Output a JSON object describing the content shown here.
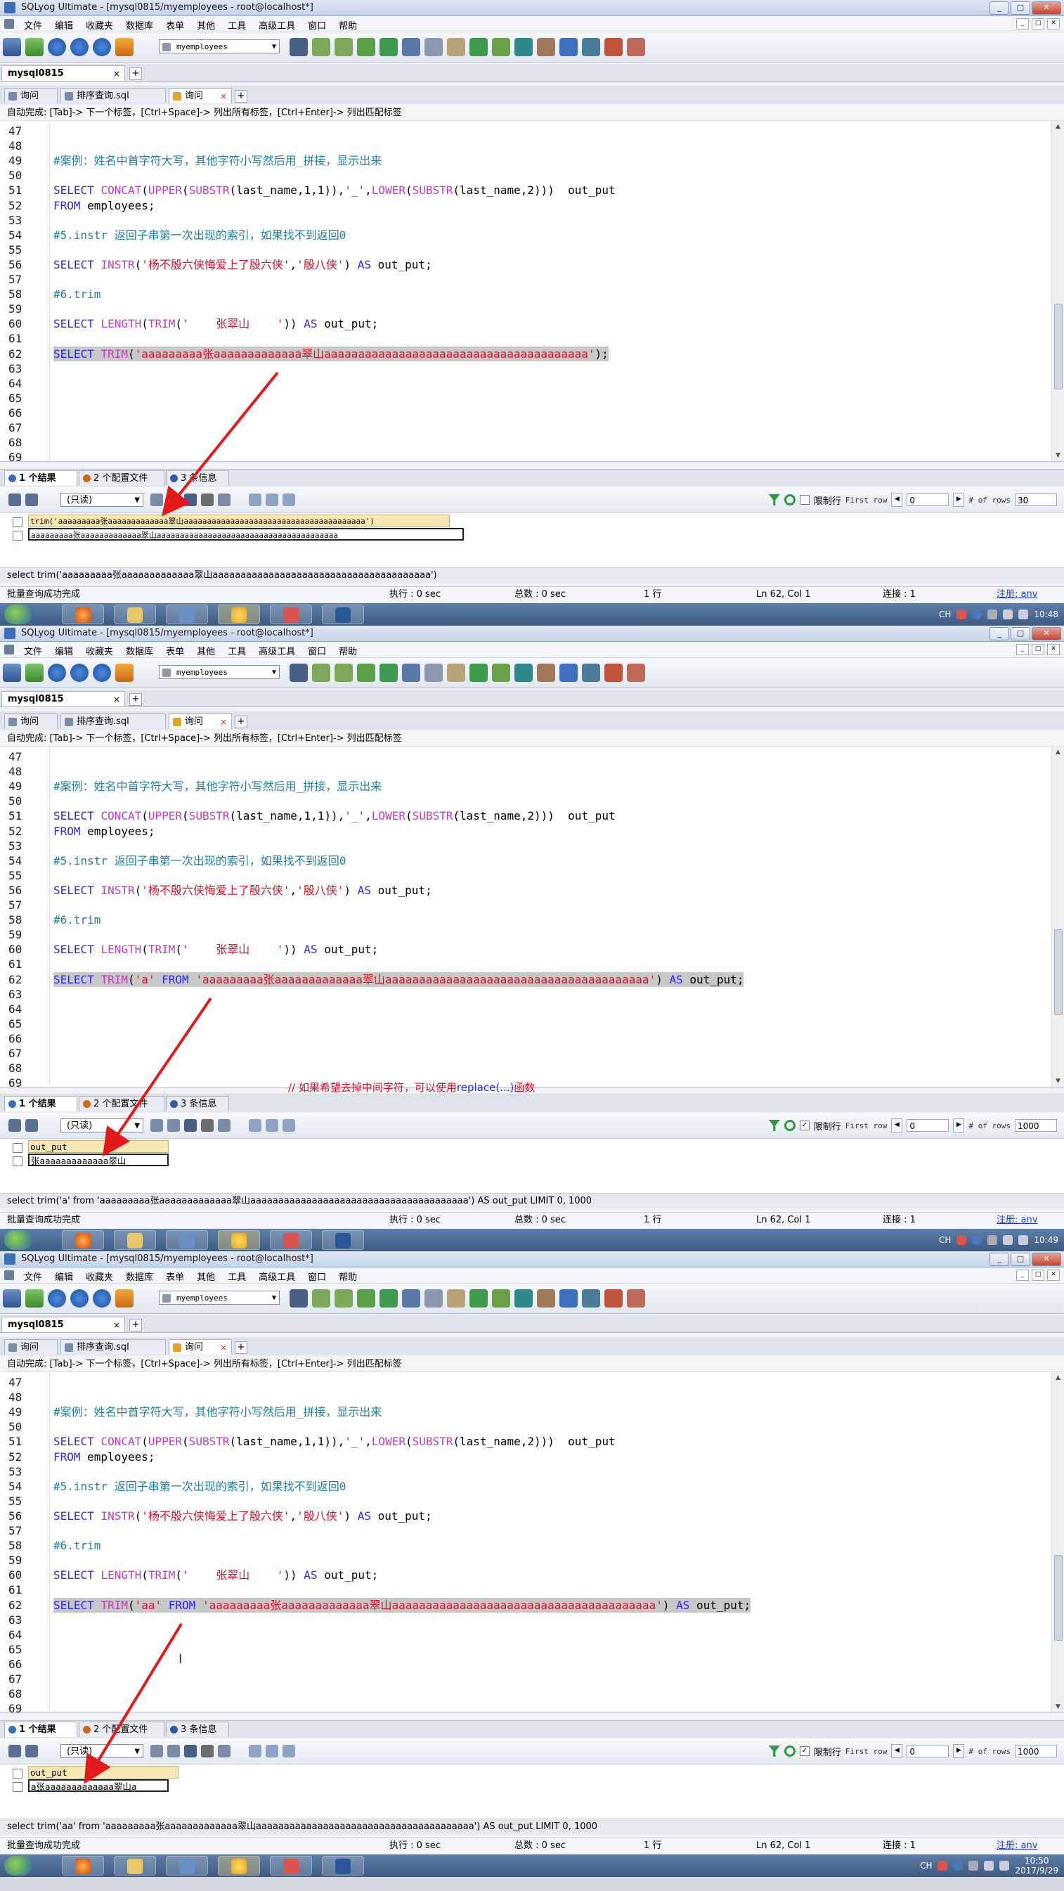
{
  "app": {
    "window_title": "SQLyog Ultimate - [mysql0815/myemployees - root@localhost*]",
    "menu": [
      "文件",
      "编辑",
      "收藏夹",
      "数据库",
      "表单",
      "其他",
      "工具",
      "高级工具",
      "窗口",
      "帮助"
    ],
    "database": "myemployees",
    "connection_tab": "mysql0815",
    "query_tabs": [
      "询问",
      "排序查询.sql",
      "询问"
    ],
    "autocomplete_hint": "自动完成: [Tab]-> 下一个标签，[Ctrl+Space]-> 列出所有标签，[Ctrl+Enter]-> 列出匹配标签",
    "readonly_label": "(只读)",
    "limit_label": "限制行",
    "first_row_label": "First row",
    "rows_label": "# of rows",
    "status_batch": "批量查询成功完成",
    "status_exec": "执行 : 0 sec",
    "status_total": "总数 : 0 sec",
    "status_rows": "1 行",
    "status_pos": "Ln 62, Col 1",
    "status_conn": "连接 : 1",
    "status_reg": "注册: anv",
    "tray_lang": "CH",
    "win_min": "_",
    "win_max": "□",
    "win_close": "✕",
    "tab_close": "×",
    "add_tab": "+"
  },
  "code": {
    "l47": "47",
    "l48": "48",
    "l49": "49",
    "l50": "50",
    "l51": "51",
    "l52": "52",
    "l53": "53",
    "l54": "54",
    "l55": "55",
    "l56": "56",
    "l57": "57",
    "l58": "58",
    "l59": "59",
    "l60": "60",
    "l61": "61",
    "l62": "62",
    "l63": "63",
    "l64": "64",
    "l65": "65",
    "l66": "66",
    "l67": "67",
    "l68": "68",
    "l69": "69",
    "comment_case": "#案例：姓名中首字符大写，其他字符小写然后用_拼接，显示出来",
    "select_kw": "SELECT",
    "from_kw": "FROM",
    "as_kw": "AS",
    "concat_fn": "CONCAT",
    "upper_fn": "UPPER",
    "substr_fn": "SUBSTR",
    "lower_fn": "LOWER",
    "instr_fn": "INSTR",
    "length_fn": "LENGTH",
    "trim_fn": "TRIM",
    "concat_args1": "(",
    "concat_args2": "(",
    "concat_args3": "(last_name,1,1)),",
    "concat_sep": "'_'",
    "concat_comma": ",",
    "concat_args4": "(last_name,2)))  out_put",
    "from_tail": " employees;",
    "comment_instr": "#5.instr 返回子串第一次出现的索引，如果找不到返回0",
    "instr_args_open": "(",
    "instr_str1": "'杨不殷六侠悔爱上了殷六侠'",
    "instr_str2": "'殷八侠'",
    "instr_tail": " out_put;",
    "comment_trim": "#6.trim",
    "length_str": "'    张翠山    '",
    "length_tail": ")) ",
    "trim_str": "'aaaaaaaaa张aaaaaaaaaaaaa翠山aaaaaaaaaaaaaaaaaaaaaaaaaaaaaaaaaaaaaaa'",
    "trim_a": "'a'",
    "trim_aa": "'aa'",
    "semicolon": ";",
    "paren_open": "(",
    "paren_close": ")",
    "comma": ","
  },
  "panels": [
    {
      "time": "10:48",
      "result_tabs": [
        "1 个结果",
        "2 个配置文件",
        "3 条信息"
      ],
      "first_row": "0",
      "rows": "30",
      "limit_checked": false,
      "result_header": "trim('aaaaaaaaa张aaaaaaaaaaaaa翠山aaaaaaaaaaaaaaaaaaaaaaaaaaaaaaaaaaaaaaa')",
      "result_value": "aaaaaaaaa张aaaaaaaaaaaaa翠山aaaaaaaaaaaaaaaaaaaaaaaaaaaaaaaaaaaaaaa",
      "sql": "select trim('aaaaaaaaa张aaaaaaaaaaaaa翠山aaaaaaaaaaaaaaaaaaaaaaaaaaaaaaaaaaaaaaa')"
    },
    {
      "time": "10:49",
      "result_tabs": [
        "1 个结果",
        "2 个配置文件",
        "3 条信息"
      ],
      "first_row": "0",
      "rows": "1000",
      "limit_checked": true,
      "result_header": "out_put",
      "result_value": "张aaaaaaaaaaaaa翠山",
      "sql": "select trim('a' from 'aaaaaaaaa张aaaaaaaaaaaaa翠山aaaaaaaaaaaaaaaaaaaaaaaaaaaaaaaaaaaaaaa')  AS out_put LIMIT 0, 1000",
      "annotation_prefix": "// 如果希望去掉中间字符，可以使用",
      "annotation_blue": "replace(...)",
      "annotation_suffix": "函数"
    },
    {
      "time": "10:50",
      "date": "2017/9/29",
      "result_tabs": [
        "1 个结果",
        "2 个配置文件",
        "3 条信息"
      ],
      "first_row": "0",
      "rows": "1000",
      "limit_checked": true,
      "result_header": "out_put",
      "result_value": "a张aaaaaaaaaaaaa翠山a",
      "sql": "select trim('aa' from 'aaaaaaaaa张aaaaaaaaaaaaa翠山aaaaaaaaaaaaaaaaaaaaaaaaaaaaaaaaaaaaaaa')  AS out_put LIMIT 0, 1000"
    }
  ],
  "colors": {
    "keyword": "#2a2aff",
    "function": "#c33bc0",
    "string": "#d3142a",
    "comment": "#1f7fa3",
    "arrow": "#e21a1a",
    "selection": "#c8c8c8"
  }
}
